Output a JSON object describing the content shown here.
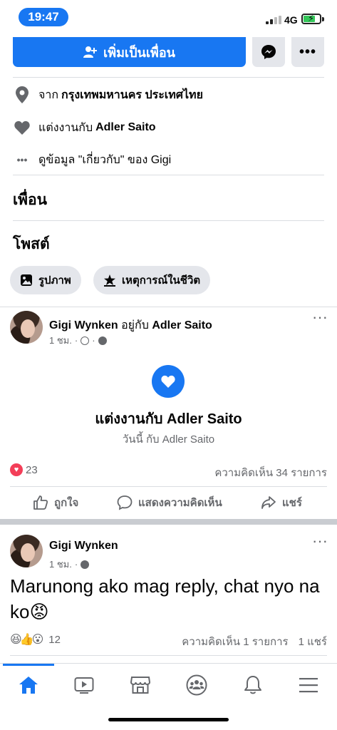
{
  "status_bar": {
    "time": "19:47",
    "network": "4G"
  },
  "profile_actions": {
    "add_friend_label": "เพิ่มเป็นเพื่อน"
  },
  "intro": {
    "from_prefix": "จาก",
    "from_place": "กรุงเทพมหานคร ประเทศไทย",
    "married_prefix": "แต่งงานกับ",
    "married_to": "Adler Saito",
    "about_text": "ดูข้อมูล \"เกี่ยวกับ\" ของ Gigi"
  },
  "sections": {
    "friends": "เพื่อน",
    "posts": "โพสต์"
  },
  "filters": [
    {
      "label": "รูปภาพ"
    },
    {
      "label": "เหตุการณ์ในชีวิต"
    }
  ],
  "post1": {
    "author": "Gigi Wynken",
    "with_text": "อยู่กับ",
    "with_name": "Adler Saito",
    "time": "1 ชม.",
    "life_event_title": "แต่งงานกับ Adler Saito",
    "life_event_sub": "วันนี้ กับ Adler Saito",
    "reaction_count": "23",
    "comments": "ความคิดเห็น 34 รายการ",
    "actions": {
      "like": "ถูกใจ",
      "comment": "แสดงความคิดเห็น",
      "share": "แชร์"
    }
  },
  "post2": {
    "author": "Gigi Wynken",
    "time": "1 ชม.",
    "text": "Marunong ako mag reply, chat nyo na ko😡",
    "reaction_count": "12",
    "comments": "ความคิดเห็น 1 รายการ",
    "shares": "1 แชร์"
  },
  "nav": [
    "home-icon",
    "watch-icon",
    "marketplace-icon",
    "groups-icon",
    "notifications-icon",
    "menu-icon"
  ],
  "colors": {
    "accent": "#1877f2",
    "chip_bg": "#e4e6eb",
    "muted": "#65676b",
    "love": "#f33e58"
  }
}
